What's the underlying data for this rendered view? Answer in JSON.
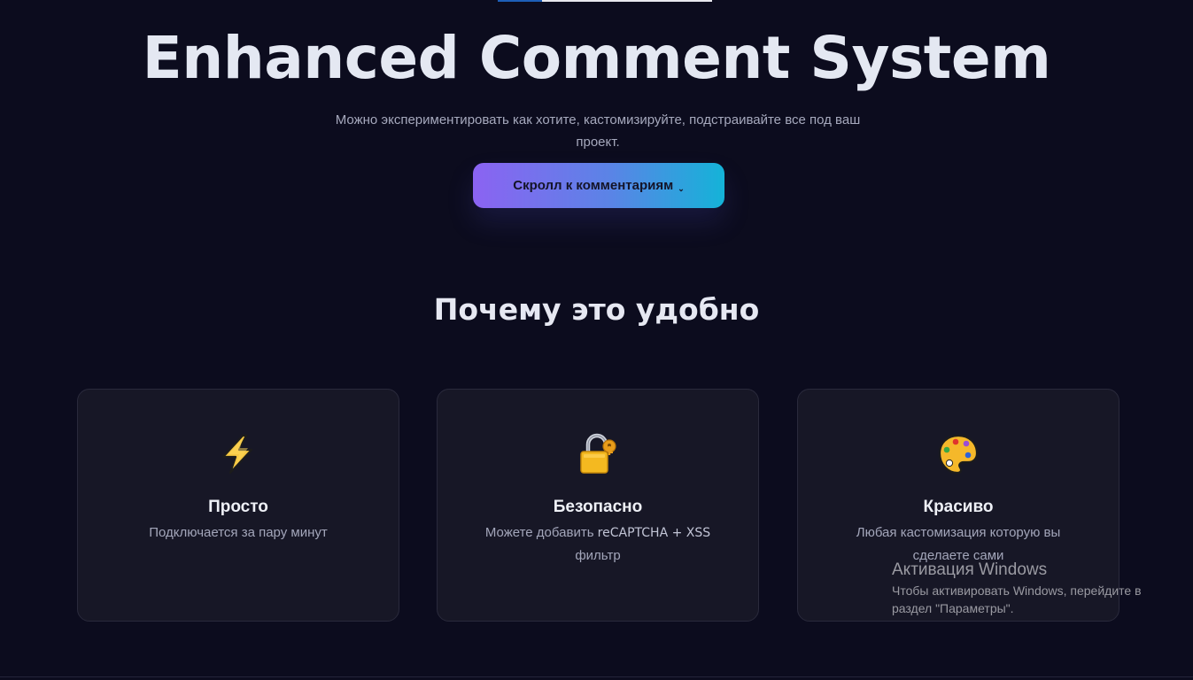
{
  "hero": {
    "title": "Enhanced Comment System",
    "subtitle": "Можно экспериментировать как хотите, кастомизируйте, подстраивайте все под ваш проект.",
    "button_label": "Скролл к комментариям",
    "button_icon": "chevron-down-icon"
  },
  "features": {
    "title": "Почему это удобно",
    "cards": [
      {
        "icon": "lightning-icon",
        "title": "Просто",
        "text": "Подключается за пару минут"
      },
      {
        "icon": "lock-icon",
        "title": "Безопасно",
        "text_prefix": "Можете добавить ",
        "text_code": "reCAPTCHA + XSS",
        "text_suffix": " фильтр"
      },
      {
        "icon": "palette-icon",
        "title": "Красиво",
        "text": "Любая кастомизация которую вы сделаете сами"
      }
    ]
  },
  "watermark": {
    "title": "Активация Windows",
    "text": "Чтобы активировать Windows, перейдите в раздел \"Параметры\"."
  },
  "colors": {
    "background": "#0c0c1e",
    "card": "#171726",
    "gradient_start": "#8b63f2",
    "gradient_end": "#14b3d8"
  }
}
